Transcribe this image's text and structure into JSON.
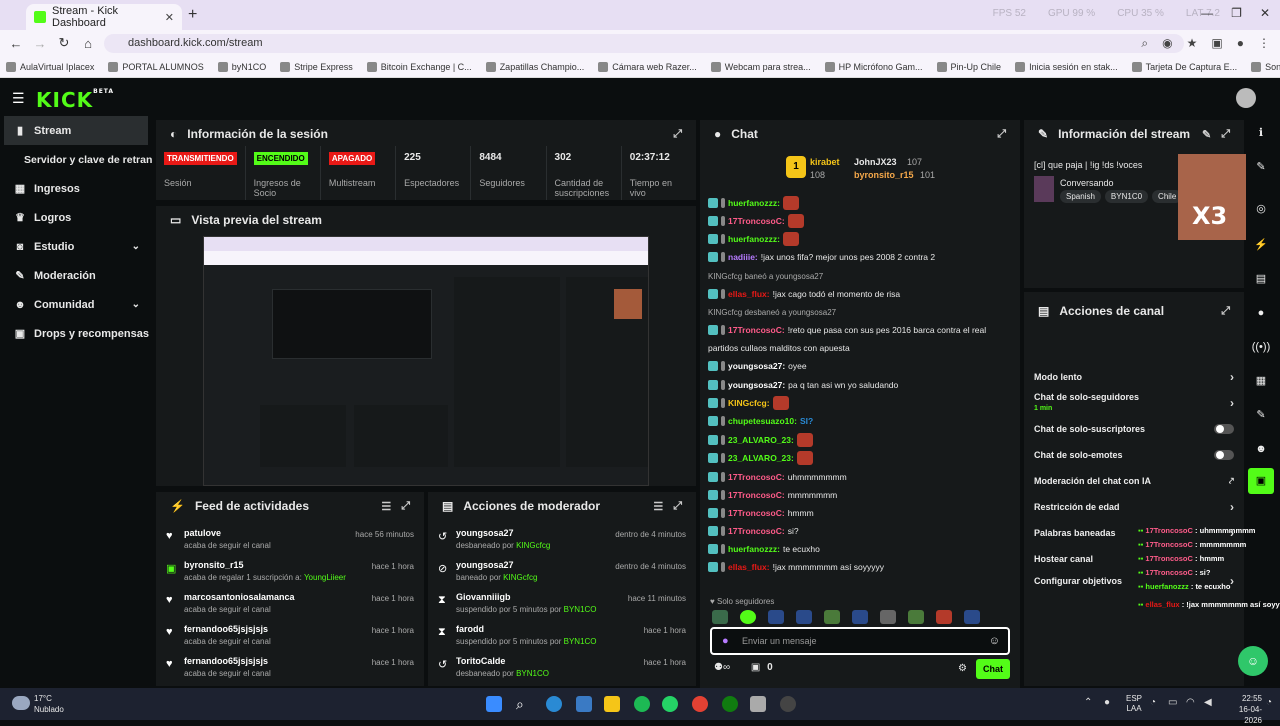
{
  "browser": {
    "tab_title": "Stream - Kick Dashboard",
    "url": "dashboard.kick.com/stream",
    "stats": [
      "FPS 52",
      "GPU 99 %",
      "CPU 35 %",
      "LAT 7.2"
    ],
    "bookmarks": [
      "AulaVirtual Iplacex",
      "PORTAL ALUMNOS",
      "byN1CO",
      "Stripe Express",
      "Bitcoin Exchange | C...",
      "Zapatillas Champio...",
      "Cámara web Razer...",
      "Webcam para strea...",
      "HP Micrófono Gam...",
      "Pin-Up Chile",
      "Inicia sesión en stak...",
      "Tarjeta De Captura E...",
      "Sony Consola PlaySt..."
    ]
  },
  "app": {
    "logo": "KICK",
    "logo_badge": "BETA"
  },
  "sidebar": {
    "items": [
      {
        "label": "Stream"
      },
      {
        "label": "Servidor y clave de retransmisión"
      },
      {
        "label": "Ingresos"
      },
      {
        "label": "Logros"
      },
      {
        "label": "Estudio"
      },
      {
        "label": "Moderación"
      },
      {
        "label": "Comunidad"
      },
      {
        "label": "Drops y recompensas"
      }
    ]
  },
  "session": {
    "title": "Información de la sesión",
    "stats": [
      {
        "badge": "TRANSMITIENDO",
        "label": "Sesión"
      },
      {
        "badge": "ENCENDIDO",
        "label": "Ingresos de Socio"
      },
      {
        "badge": "APAGADO",
        "label": "Multistream"
      },
      {
        "value": "225",
        "label": "Espectadores"
      },
      {
        "value": "8484",
        "label": "Seguidores"
      },
      {
        "value": "302",
        "label": "Cantidad de suscripciones"
      },
      {
        "value": "02:37:12",
        "label": "Tiempo en vivo"
      }
    ]
  },
  "preview": {
    "title": "Vista previa del stream"
  },
  "activity": {
    "title": "Feed de actividades",
    "rows": [
      {
        "name": "patulove",
        "sub": "acaba de seguir el canal",
        "time": "hace 56 minutos"
      },
      {
        "name": "byronsito_r15",
        "sub": "acaba de regalar 1 suscripción a: ",
        "sub2": "YoungLiieer",
        "time": "hace 1 hora"
      },
      {
        "name": "marcosantoniosalamanca",
        "sub": "acaba de seguir el canal",
        "time": "hace 1 hora"
      },
      {
        "name": "fernandoo65jsjsjsjs",
        "sub": "acaba de seguir el canal",
        "time": "hace 1 hora"
      },
      {
        "name": "fernandoo65jsjsjsjs",
        "sub": "acaba de seguir el canal",
        "time": "hace 1 hora"
      }
    ]
  },
  "moderator": {
    "title": "Acciones de moderador",
    "rows": [
      {
        "name": "youngsosa27",
        "sub": "desbaneado por ",
        "by": "KINGcfcg",
        "time": "dentro de 4 minutos"
      },
      {
        "name": "youngsosa27",
        "sub": "baneado por ",
        "by": "KINGcfcg",
        "time": "dentro de 4 minutos"
      },
      {
        "name": "Giovanniiigb",
        "sub": "suspendido por 5 minutos por ",
        "by": "BYN1CO",
        "time": "hace 11 minutos"
      },
      {
        "name": "farodd",
        "sub": "suspendido por 5 minutos por ",
        "by": "BYN1CO",
        "time": "hace 1 hora"
      },
      {
        "name": "ToritoCalde",
        "sub": "desbaneado por ",
        "by": "BYN1CO",
        "time": "hace 1 hora"
      }
    ]
  },
  "chat": {
    "title": "Chat",
    "top": [
      {
        "name": "kirabet",
        "count": "108"
      },
      {
        "name": "JohnJX23",
        "count": "107"
      },
      {
        "name": "byronsito_r15",
        "count": "101"
      }
    ],
    "rank": "1",
    "lines": [
      {
        "name": "huerfanozzz:",
        "color": "#53fc18",
        "text": ""
      },
      {
        "name": "17TroncosoC:",
        "color": "#ff5c8a",
        "text": ""
      },
      {
        "name": "huerfanozzz:",
        "color": "#53fc18",
        "text": ""
      },
      {
        "name": "nadiiie:",
        "color": "#b77bff",
        "text": "!jax unos fifa? mejor unos pes 2008 2 contra 2"
      },
      {
        "sys": "KINGcfcg baneó a youngsosa27"
      },
      {
        "name": "ellas_flux:",
        "color": "#e91916",
        "text": "!jax cago todó el momento de risa"
      },
      {
        "sys": "KINGcfcg desbaneó a youngsosa27"
      },
      {
        "name": "17TroncosoC:",
        "color": "#ff5c8a",
        "text": "!reto que pasa con sus pes 2016 barca contra el real"
      },
      {
        "cont": "partidos cullaos malditos con apuesta"
      },
      {
        "name": "youngsosa27:",
        "color": "#fff",
        "text": "oyee"
      },
      {
        "name": "youngsosa27:",
        "color": "#fff",
        "text": "pa q tan asi wn yo saludando"
      },
      {
        "name": "KINGcfcg:",
        "color": "#f5c518",
        "text": ""
      },
      {
        "name": "chupetesuazo10:",
        "color": "#53fc18",
        "text": "SI?"
      },
      {
        "name": "23_ALVARO_23:",
        "color": "#53fc18",
        "text": ""
      },
      {
        "name": "23_ALVARO_23:",
        "color": "#53fc18",
        "text": ""
      },
      {
        "name": "17TroncosoC:",
        "color": "#ff5c8a",
        "text": "uhmmmmmmm"
      },
      {
        "name": "17TroncosoC:",
        "color": "#ff5c8a",
        "text": "mmmmmmm"
      },
      {
        "name": "17TroncosoC:",
        "color": "#ff5c8a",
        "text": "hmmm"
      },
      {
        "name": "17TroncosoC:",
        "color": "#ff5c8a",
        "text": "si?"
      },
      {
        "name": "huerfanozzz:",
        "color": "#53fc18",
        "text": "te ecuxho"
      },
      {
        "name": "ellas_flux:",
        "color": "#e91916",
        "text": "!jax mmmmmmm así soyyyyy"
      }
    ],
    "mode": "Solo seguidores",
    "placeholder": "Enviar un mensaje",
    "points": "0",
    "send": "Chat"
  },
  "stream_info": {
    "title": "Información del stream",
    "stream_title": "[cl] que paja | !ig !ds !voces",
    "category": "Conversando",
    "tags": [
      "Spanish",
      "BYN1C0",
      "Chile"
    ],
    "overlay": "X3"
  },
  "channel_actions": {
    "title": "Acciones de canal",
    "items": [
      {
        "label": "Modo lento",
        "type": "chevron"
      },
      {
        "label": "Chat de solo-seguidores",
        "sub": "1 min",
        "type": "chevron"
      },
      {
        "label": "Chat de solo-suscriptores",
        "type": "toggle"
      },
      {
        "label": "Chat de solo-emotes",
        "type": "toggle"
      },
      {
        "label": "Moderación del chat con IA",
        "type": "link"
      },
      {
        "label": "Restricción de edad",
        "type": "chevron"
      },
      {
        "label": "Palabras baneadas",
        "type": "chevron"
      },
      {
        "label": "Hostear canal",
        "type": "none"
      },
      {
        "label": "Configurar objetivos",
        "type": "chevron"
      }
    ]
  },
  "overlay_chat": [
    {
      "name": "17TroncosoC",
      "text": "uhmmmmmmm"
    },
    {
      "name": "17TroncosoC",
      "text": "mmmmmmm"
    },
    {
      "name": "17TroncosoC",
      "text": "hmmm"
    },
    {
      "name": "17TroncosoC",
      "text": "si?"
    },
    {
      "name": "huerfanozzz",
      "text": "te ecuxho"
    },
    {
      "name": "ellas_flux",
      "text": "!jax mmmmmmm así soyyyyy"
    }
  ],
  "taskbar": {
    "weather_temp": "17°C",
    "weather_desc": "Nublado",
    "lang": "ESP",
    "lang2": "LAA",
    "time": "22:55",
    "date": "16-04-2026"
  },
  "colors": {
    "kick_green": "#53fc18",
    "panel": "#16191a",
    "bg": "#0b0e0f"
  }
}
